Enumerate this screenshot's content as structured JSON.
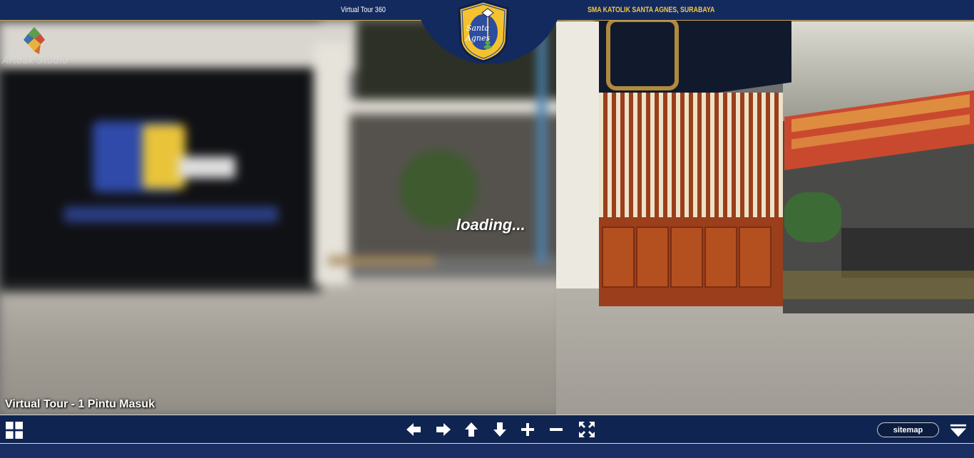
{
  "header": {
    "left_title": "Virtual Tour 360",
    "right_title": "SMA KATOLIK SANTA AGNES, SURABAYA",
    "logo_text_line1": "Santa",
    "logo_text_line2": "Agnes"
  },
  "watermark": {
    "label": "Artoak Studio"
  },
  "viewer": {
    "loading_text": "loading...",
    "scene_title": "Virtual Tour - 1 Pintu Masuk"
  },
  "controls": {
    "icons": [
      "grid-icon",
      "arrow-left-icon",
      "arrow-right-icon",
      "arrow-up-icon",
      "arrow-down-icon",
      "zoom-in-icon",
      "zoom-out-icon",
      "fullscreen-icon",
      "menu-triangle-icon"
    ],
    "sitemap_label": "sitemap"
  },
  "colors": {
    "header_bg": "#132a5e",
    "accent_gold": "#c7a750",
    "bottom_bar_bg": "#0f2450",
    "right_title_color": "#f5c842"
  }
}
